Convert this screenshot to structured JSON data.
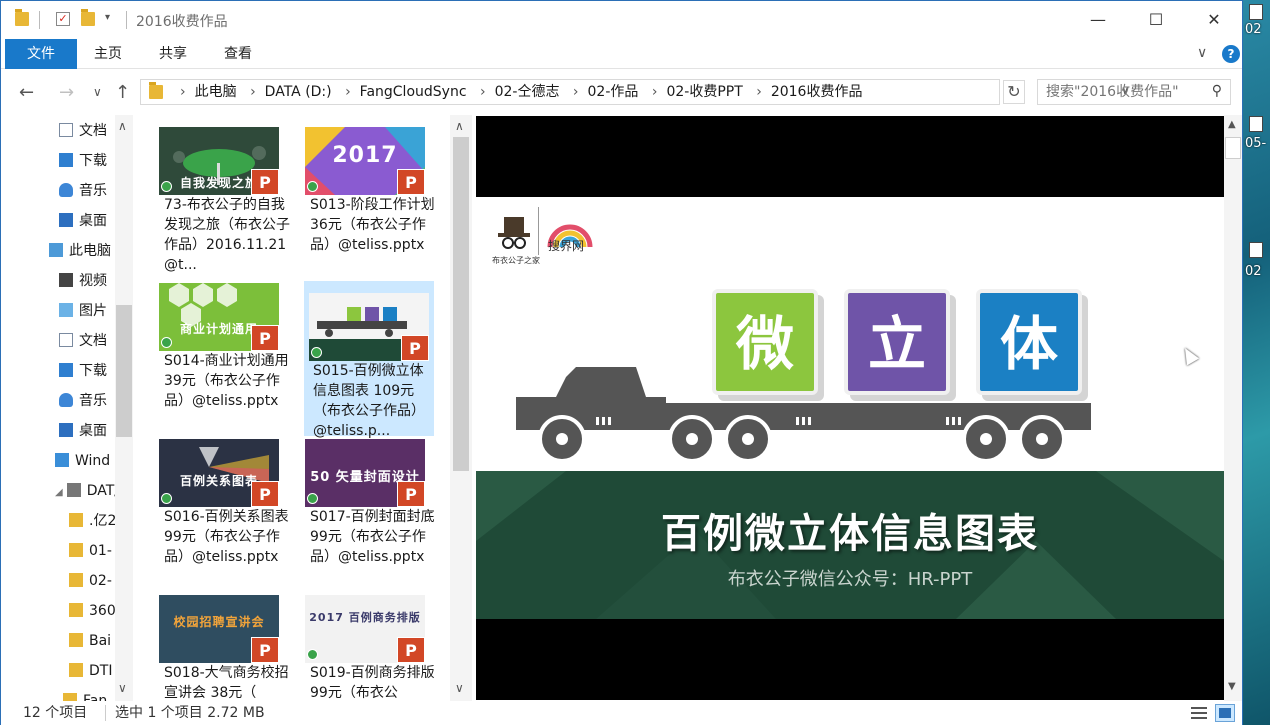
{
  "window": {
    "title": "2016收费作品"
  },
  "ribbon": {
    "tabs": [
      "文件",
      "主页",
      "共享",
      "查看"
    ],
    "help_label": "?"
  },
  "address": {
    "crumbs": [
      "此电脑",
      "DATA (D:)",
      "FangCloudSync",
      "02-仝德志",
      "02-作品",
      "02-收费PPT",
      "2016收费作品"
    ]
  },
  "search": {
    "placeholder": "搜索\"2016收费作品\""
  },
  "nav_pane": {
    "items": [
      {
        "label": "文档",
        "icon": "document-icon"
      },
      {
        "label": "下载",
        "icon": "download-icon"
      },
      {
        "label": "音乐",
        "icon": "music-icon"
      },
      {
        "label": "桌面",
        "icon": "desktop-icon"
      },
      {
        "label": "此电脑",
        "icon": "pc-icon"
      },
      {
        "label": "视频",
        "icon": "video-icon"
      },
      {
        "label": "图片",
        "icon": "picture-icon"
      },
      {
        "label": "文档",
        "icon": "document-icon"
      },
      {
        "label": "下载",
        "icon": "download-icon"
      },
      {
        "label": "音乐",
        "icon": "music-icon"
      },
      {
        "label": "桌面",
        "icon": "desktop-icon"
      },
      {
        "label": "Wind",
        "icon": "windows-drive-icon"
      },
      {
        "label": "DAT/",
        "icon": "drive-icon"
      },
      {
        "label": ".亿2",
        "icon": "folder-icon"
      },
      {
        "label": "01-",
        "icon": "folder-icon"
      },
      {
        "label": "02-",
        "icon": "folder-icon"
      },
      {
        "label": "360",
        "icon": "folder-icon"
      },
      {
        "label": "Bai",
        "icon": "folder-icon"
      },
      {
        "label": "DTI",
        "icon": "folder-icon"
      },
      {
        "label": "Fan",
        "icon": "folder-icon"
      }
    ]
  },
  "files": [
    {
      "name": "73-布衣公子的自我发现之旅（布衣公子作品）2016.11.21@t...",
      "thumb_text": "自我发现之旅",
      "thumb_color": "#2f4a3a",
      "selected": false
    },
    {
      "name": "S013-阶段工作计划 36元（布衣公子作品）@teliss.pptx",
      "thumb_text": "2017",
      "thumb_color": "#8a5bd1",
      "selected": false
    },
    {
      "name": "S014-商业计划通用 39元（布衣公子作品）@teliss.pptx",
      "thumb_text": "商业计划通用",
      "thumb_color": "#7cbf3a",
      "selected": false
    },
    {
      "name": "S015-百例微立体信息图表 109元（布衣公子作品）@teliss.p...",
      "thumb_text": "微 立 体",
      "thumb_color": "#f4f4f4",
      "selected": true
    },
    {
      "name": "S016-百例关系图表 99元（布衣公子作品）@teliss.pptx",
      "thumb_text": "百例关系图表",
      "thumb_color": "#2b3244",
      "selected": false
    },
    {
      "name": "S017-百例封面封底 99元（布衣公子作品）@teliss.pptx",
      "thumb_text": "50 矢量封面设计",
      "thumb_color": "#5a2f66",
      "selected": false
    },
    {
      "name": "S018-大气商务校招宣讲会 38元（",
      "thumb_text": "校园招聘宣讲会",
      "thumb_color": "#2f4d60",
      "selected": false
    },
    {
      "name": "S019-百例商务排版 99元（布衣公",
      "thumb_text": "2017 百例商务排版",
      "thumb_color": "#f2f2f2",
      "selected": false
    }
  ],
  "preview": {
    "logo_caption_left": "布衣公子之家",
    "logo_caption_right": "搜界网",
    "tiles": [
      {
        "char": "微",
        "color": "#8cc63e"
      },
      {
        "char": "立",
        "color": "#6f54a8"
      },
      {
        "char": "体",
        "color": "#1b80c4"
      }
    ],
    "title": "百例微立体信息图表",
    "subtitle": "布衣公子微信公众号：HR-PPT"
  },
  "status": {
    "item_count": "12 个项目",
    "selection": "选中 1 个项目  2.72 MB"
  },
  "desktop": {
    "labels": [
      "02",
      "05-",
      "02"
    ]
  }
}
